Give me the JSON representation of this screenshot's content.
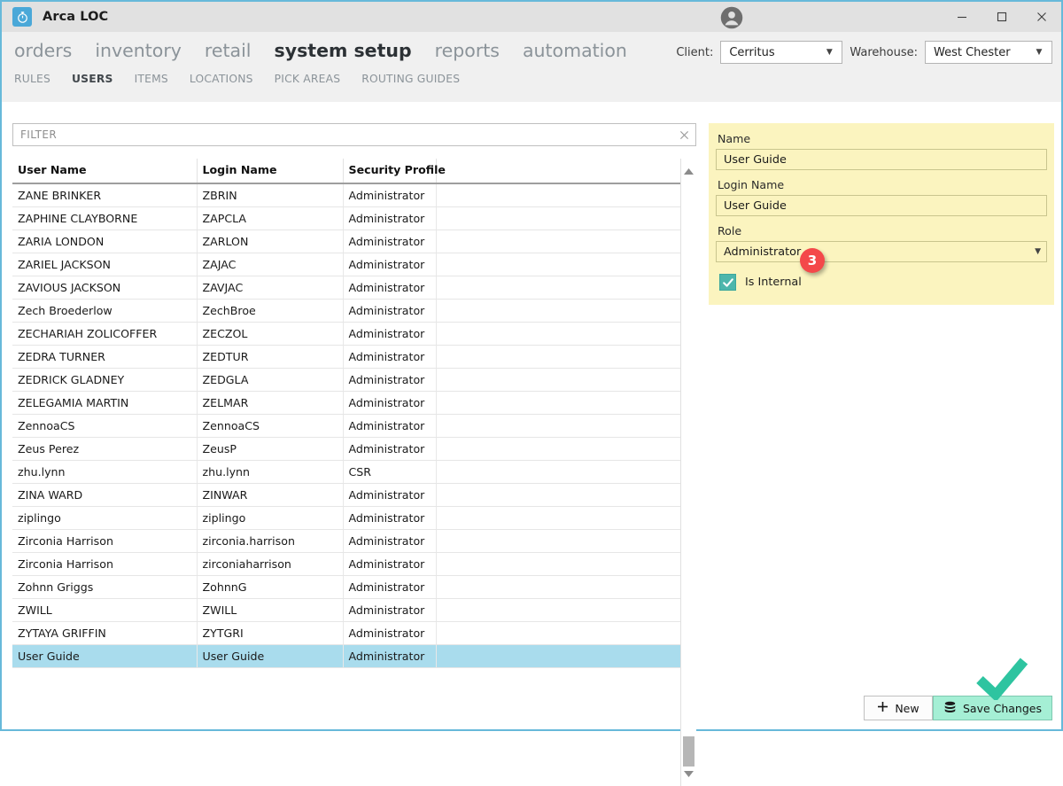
{
  "window": {
    "title": "Arca LOC",
    "app_icon": "stopwatch-icon",
    "minimize": "–",
    "maximize": "□",
    "close": "✕",
    "accent_border": "#67b9da",
    "titlebar_bg": "#e1e1e1"
  },
  "account": {
    "icon": "user-avatar-icon"
  },
  "nav": {
    "main": [
      {
        "label": "orders",
        "active": false
      },
      {
        "label": "inventory",
        "active": false
      },
      {
        "label": "retail",
        "active": false
      },
      {
        "label": "system setup",
        "active": true
      },
      {
        "label": "reports",
        "active": false
      },
      {
        "label": "automation",
        "active": false
      }
    ],
    "sub": [
      {
        "label": "RULES",
        "active": false
      },
      {
        "label": "USERS",
        "active": true
      },
      {
        "label": "ITEMS",
        "active": false
      },
      {
        "label": "LOCATIONS",
        "active": false
      },
      {
        "label": "PICK AREAS",
        "active": false
      },
      {
        "label": "ROUTING GUIDES",
        "active": false
      }
    ]
  },
  "selectors": {
    "client_label": "Client:",
    "client_value": "Cerritus",
    "warehouse_label": "Warehouse:",
    "warehouse_value": "West Chester"
  },
  "filter": {
    "placeholder": "FILTER",
    "value": "",
    "clear_icon": "close-x-icon"
  },
  "table": {
    "columns": [
      "User Name",
      "Login Name",
      "Security Profile",
      ""
    ],
    "rows": [
      {
        "user_name": "ZANE BRINKER",
        "login_name": "ZBRIN",
        "security_profile": "Administrator",
        "selected": false
      },
      {
        "user_name": "ZAPHINE CLAYBORNE",
        "login_name": "ZAPCLA",
        "security_profile": "Administrator",
        "selected": false
      },
      {
        "user_name": "ZARIA LONDON",
        "login_name": "ZARLON",
        "security_profile": "Administrator",
        "selected": false
      },
      {
        "user_name": "ZARIEL JACKSON",
        "login_name": "ZAJAC",
        "security_profile": "Administrator",
        "selected": false
      },
      {
        "user_name": "ZAVIOUS JACKSON",
        "login_name": "ZAVJAC",
        "security_profile": "Administrator",
        "selected": false
      },
      {
        "user_name": "Zech Broederlow",
        "login_name": "ZechBroe",
        "security_profile": "Administrator",
        "selected": false
      },
      {
        "user_name": "ZECHARIAH ZOLICOFFER",
        "login_name": "ZECZOL",
        "security_profile": "Administrator",
        "selected": false
      },
      {
        "user_name": "ZEDRA TURNER",
        "login_name": "ZEDTUR",
        "security_profile": "Administrator",
        "selected": false
      },
      {
        "user_name": "ZEDRICK GLADNEY",
        "login_name": "ZEDGLA",
        "security_profile": "Administrator",
        "selected": false
      },
      {
        "user_name": "ZELEGAMIA MARTIN",
        "login_name": "ZELMAR",
        "security_profile": "Administrator",
        "selected": false
      },
      {
        "user_name": "ZennoaCS",
        "login_name": "ZennoaCS",
        "security_profile": "Administrator",
        "selected": false
      },
      {
        "user_name": "Zeus Perez",
        "login_name": "ZeusP",
        "security_profile": "Administrator",
        "selected": false
      },
      {
        "user_name": "zhu.lynn",
        "login_name": "zhu.lynn",
        "security_profile": "CSR",
        "selected": false
      },
      {
        "user_name": "ZINA WARD",
        "login_name": "ZINWAR",
        "security_profile": "Administrator",
        "selected": false
      },
      {
        "user_name": "ziplingo",
        "login_name": "ziplingo",
        "security_profile": "Administrator",
        "selected": false
      },
      {
        "user_name": "Zirconia Harrison",
        "login_name": "zirconia.harrison",
        "security_profile": "Administrator",
        "selected": false
      },
      {
        "user_name": "Zirconia Harrison",
        "login_name": "zirconiaharrison",
        "security_profile": "Administrator",
        "selected": false
      },
      {
        "user_name": "Zohnn Griggs",
        "login_name": "ZohnnG",
        "security_profile": "Administrator",
        "selected": false
      },
      {
        "user_name": "ZWILL",
        "login_name": "ZWILL",
        "security_profile": "Administrator",
        "selected": false
      },
      {
        "user_name": "ZYTAYA GRIFFIN",
        "login_name": "ZYTGRI",
        "security_profile": "Administrator",
        "selected": false
      },
      {
        "user_name": "User Guide",
        "login_name": "User Guide",
        "security_profile": "Administrator",
        "selected": true
      }
    ],
    "selected_row_color": "#a9dced"
  },
  "scrollbar": {
    "up_icon": "caret-up-icon",
    "down_icon": "caret-down-icon"
  },
  "form": {
    "background": "#fbf4bf",
    "name_label": "Name",
    "name_value": "User Guide",
    "login_label": "Login Name",
    "login_value": "User Guide",
    "role_label": "Role",
    "role_value": "Administrator",
    "is_internal_label": "Is Internal",
    "is_internal_checked": true,
    "checkbox_color": "#4db6ac"
  },
  "annotation": {
    "badge_number": "3",
    "badge_color": "#f4484a",
    "check_color": "#2ec4a0"
  },
  "actions": {
    "new_label": "New",
    "new_icon": "plus-icon",
    "save_label": "Save Changes",
    "save_icon": "database-stack-icon",
    "save_color": "#a5efd5"
  }
}
